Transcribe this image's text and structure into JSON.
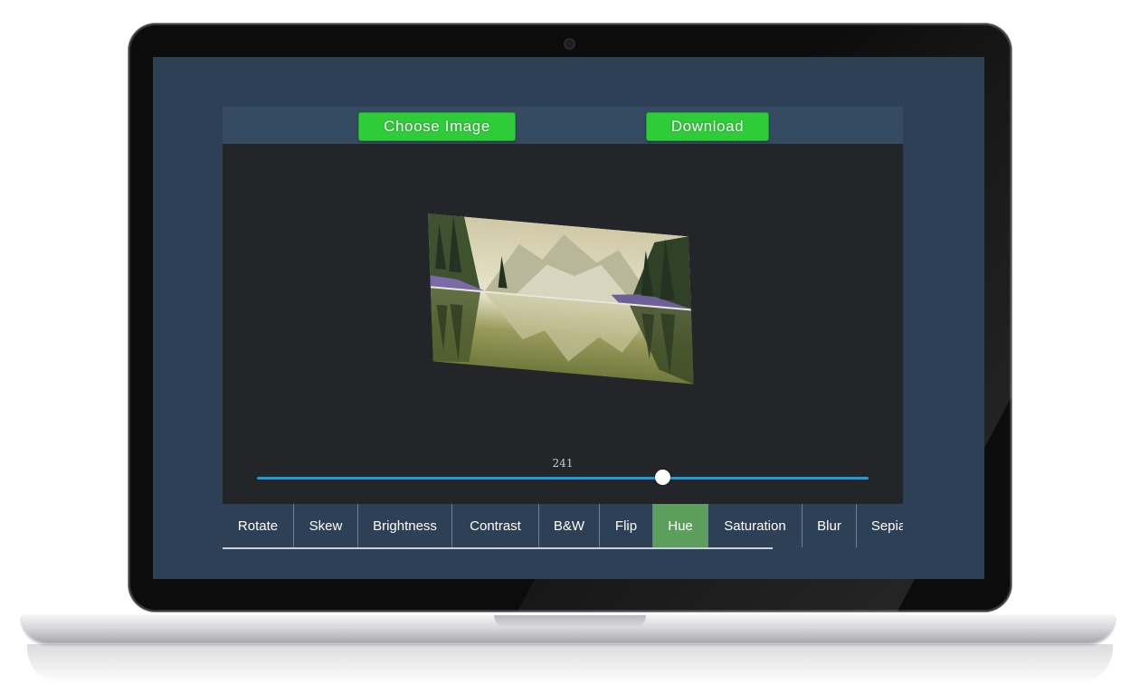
{
  "app": {
    "choose_label": "Choose Image",
    "download_label": "Download"
  },
  "slider": {
    "value": "241",
    "fraction": 0.664
  },
  "tabs": [
    {
      "label": "Rotate",
      "width": 79,
      "active": false
    },
    {
      "label": "Skew",
      "width": 71,
      "active": false
    },
    {
      "label": "Brightness",
      "width": 104,
      "active": false
    },
    {
      "label": "Contrast",
      "width": 96,
      "active": false
    },
    {
      "label": "B&W",
      "width": 67,
      "active": false
    },
    {
      "label": "Flip",
      "width": 59,
      "active": false
    },
    {
      "label": "Hue",
      "width": 61,
      "active": true
    },
    {
      "label": "Saturation",
      "width": 104,
      "active": false
    },
    {
      "label": "Blur",
      "width": 60,
      "active": false
    },
    {
      "label": "Sepia",
      "width": 71,
      "active": false
    }
  ],
  "colors": {
    "accent_button": "#2fcc39",
    "active_tab": "#5c9e5b",
    "slider_track": "#1a9de0",
    "screen_bg": "#2d4055",
    "canvas_bg": "#232528"
  },
  "icons": {
    "camera": "camera-icon"
  }
}
